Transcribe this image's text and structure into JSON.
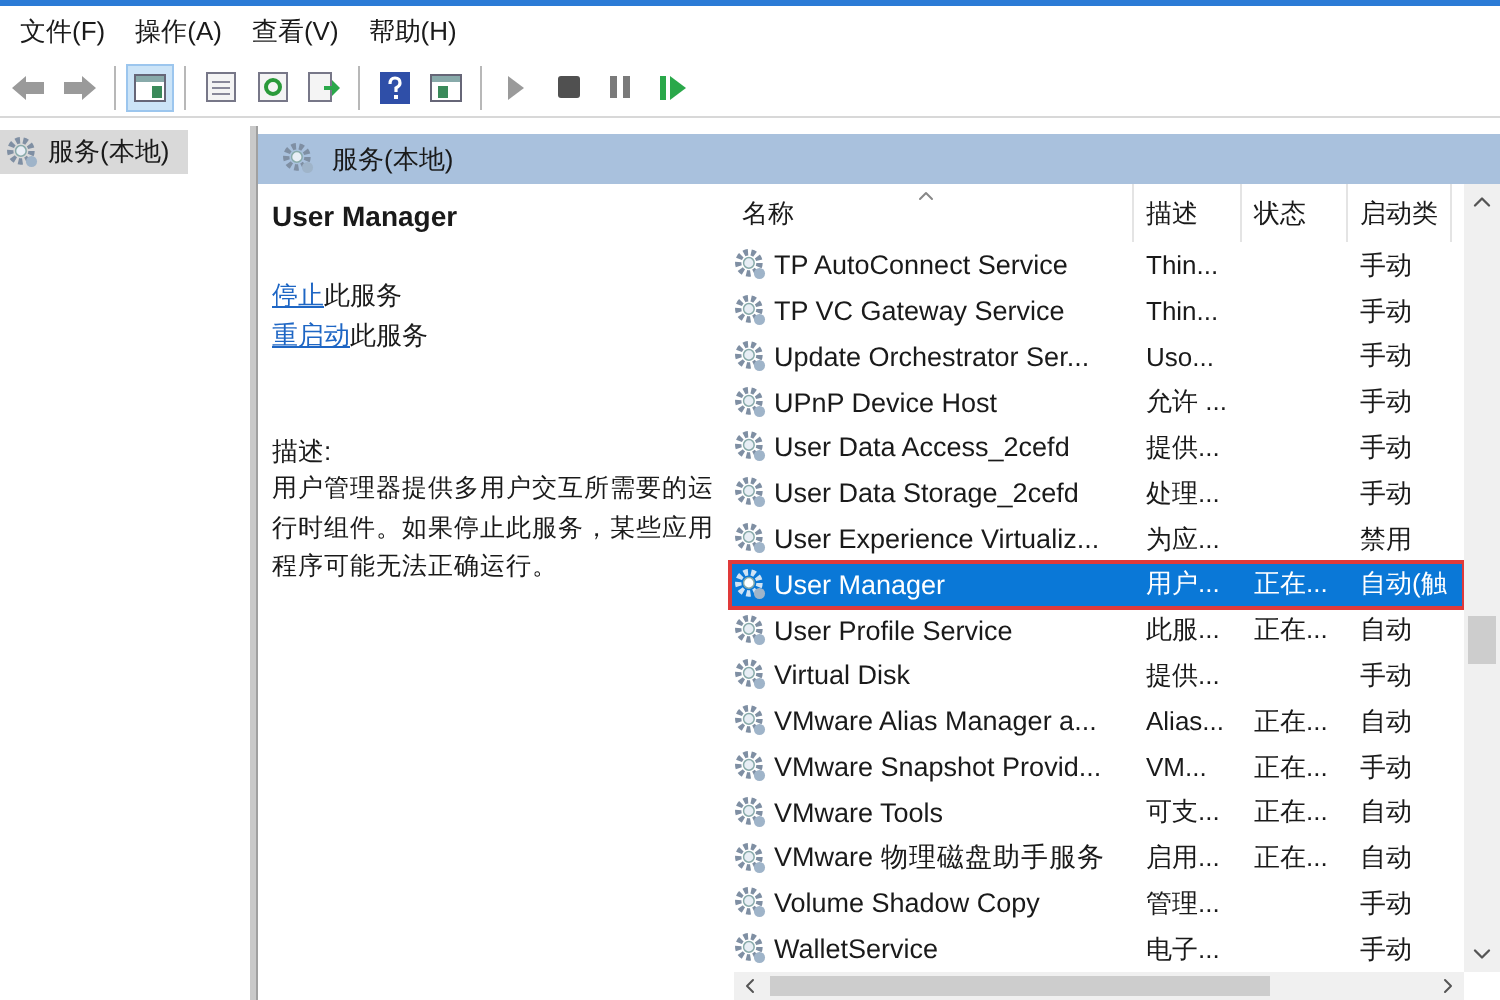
{
  "menu": [
    "文件(F)",
    "操作(A)",
    "查看(V)",
    "帮助(H)"
  ],
  "toolbar": [
    {
      "kind": "back",
      "selected": false
    },
    {
      "kind": "forward",
      "selected": false
    },
    {
      "kind": "separator"
    },
    {
      "kind": "tree",
      "selected": true
    },
    {
      "kind": "separator"
    },
    {
      "kind": "properties",
      "selected": false
    },
    {
      "kind": "refresh",
      "selected": false
    },
    {
      "kind": "export",
      "selected": false
    },
    {
      "kind": "separator"
    },
    {
      "kind": "help",
      "selected": false
    },
    {
      "kind": "view",
      "selected": false
    },
    {
      "kind": "separator"
    },
    {
      "kind": "play",
      "selected": false
    },
    {
      "kind": "stop",
      "selected": false
    },
    {
      "kind": "pause",
      "selected": false
    },
    {
      "kind": "resume",
      "selected": false
    }
  ],
  "tree": {
    "items": [
      {
        "label": "服务(本地)",
        "selected": true
      }
    ]
  },
  "pane_title": "服务(本地)",
  "details": {
    "title": "User Manager",
    "actions": [
      {
        "link": "停止",
        "text": "此服务"
      },
      {
        "link": "重启动",
        "text": "此服务"
      }
    ],
    "description_label": "描述:",
    "description": "用户管理器提供多用户交互所需要的运行时组件。如果停止此服务，某些应用程序可能无法正确运行。"
  },
  "table": {
    "columns": [
      "名称",
      "描述",
      "状态",
      "启动类"
    ],
    "rows": [
      {
        "name": "TP AutoConnect Service",
        "description": "Thin...",
        "status": "",
        "startup": "手动",
        "selected": false,
        "highlighted": false
      },
      {
        "name": "TP VC Gateway Service",
        "description": "Thin...",
        "status": "",
        "startup": "手动",
        "selected": false,
        "highlighted": false
      },
      {
        "name": "Update Orchestrator Ser...",
        "description": "Uso...",
        "status": "",
        "startup": "手动",
        "selected": false,
        "highlighted": false
      },
      {
        "name": "UPnP Device Host",
        "description": "允许 ...",
        "status": "",
        "startup": "手动",
        "selected": false,
        "highlighted": false
      },
      {
        "name": "User Data Access_2cefd",
        "description": "提供...",
        "status": "",
        "startup": "手动",
        "selected": false,
        "highlighted": false
      },
      {
        "name": "User Data Storage_2cefd",
        "description": "处理...",
        "status": "",
        "startup": "手动",
        "selected": false,
        "highlighted": false
      },
      {
        "name": "User Experience Virtualiz...",
        "description": "为应...",
        "status": "",
        "startup": "禁用",
        "selected": false,
        "highlighted": false
      },
      {
        "name": "User Manager",
        "description": "用户...",
        "status": "正在...",
        "startup": "自动(触",
        "selected": true,
        "highlighted": true
      },
      {
        "name": "User Profile Service",
        "description": "此服...",
        "status": "正在...",
        "startup": "自动",
        "selected": false,
        "highlighted": false
      },
      {
        "name": "Virtual Disk",
        "description": "提供...",
        "status": "",
        "startup": "手动",
        "selected": false,
        "highlighted": false
      },
      {
        "name": "VMware Alias Manager a...",
        "description": "Alias...",
        "status": "正在...",
        "startup": "自动",
        "selected": false,
        "highlighted": false
      },
      {
        "name": "VMware Snapshot Provid...",
        "description": "VM...",
        "status": "正在...",
        "startup": "手动",
        "selected": false,
        "highlighted": false
      },
      {
        "name": "VMware Tools",
        "description": "可支...",
        "status": "正在...",
        "startup": "自动",
        "selected": false,
        "highlighted": false
      },
      {
        "name": "VMware 物理磁盘助手服务",
        "description": "启用...",
        "status": "正在...",
        "startup": "自动",
        "selected": false,
        "highlighted": false
      },
      {
        "name": "Volume Shadow Copy",
        "description": "管理...",
        "status": "",
        "startup": "手动",
        "selected": false,
        "highlighted": false
      },
      {
        "name": "WalletService",
        "description": "电子...",
        "status": "",
        "startup": "手动",
        "selected": false,
        "highlighted": false
      }
    ]
  }
}
